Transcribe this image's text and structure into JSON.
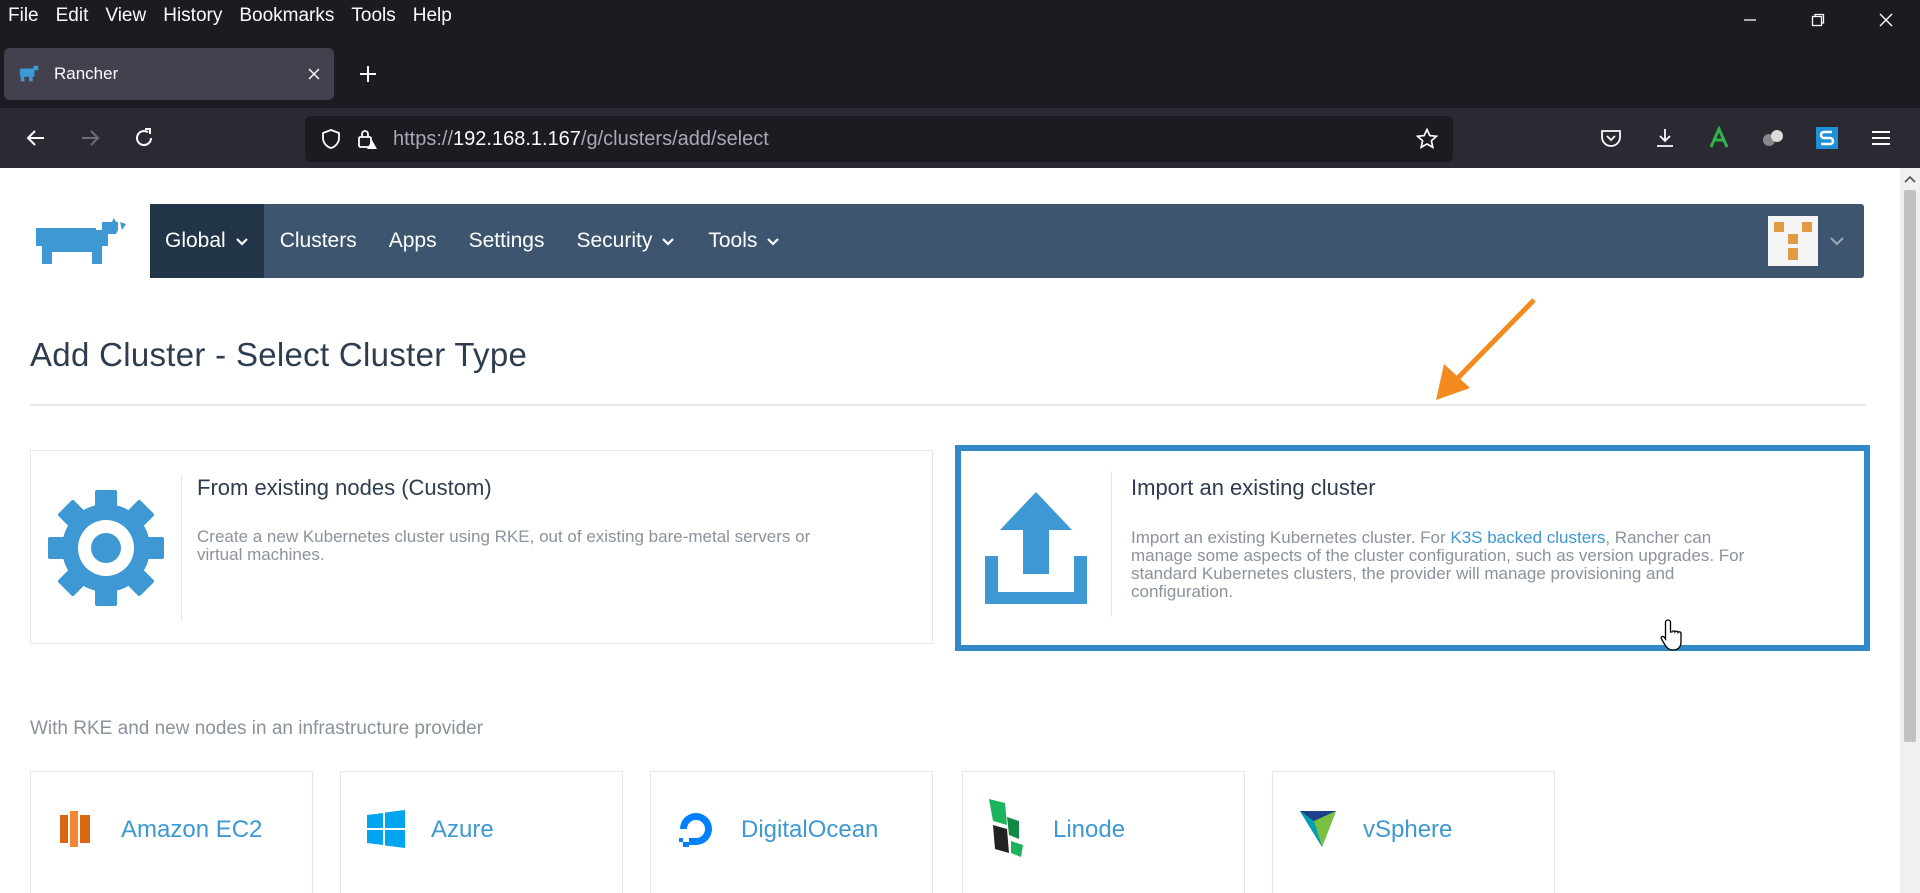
{
  "browser": {
    "menu": [
      "File",
      "Edit",
      "View",
      "History",
      "Bookmarks",
      "Tools",
      "Help"
    ],
    "tab_title": "Rancher",
    "url_prefix": "https://",
    "url_host": "192.168.1.167",
    "url_path": "/g/clusters/add/select"
  },
  "nav": {
    "items": [
      {
        "label": "Global",
        "active": true,
        "dropdown": true
      },
      {
        "label": "Clusters"
      },
      {
        "label": "Apps"
      },
      {
        "label": "Settings"
      },
      {
        "label": "Security",
        "dropdown": true
      },
      {
        "label": "Tools",
        "dropdown": true
      }
    ]
  },
  "page": {
    "title": "Add Cluster - Select Cluster Type",
    "custom_card": {
      "title": "From existing nodes (Custom)",
      "desc_1": "Create a new Kubernetes cluster using RKE, out of existing bare-metal servers or",
      "desc_2": "virtual machines."
    },
    "import_card": {
      "title": "Import an existing cluster",
      "desc_a": "Import an existing Kubernetes cluster. For ",
      "desc_link": "K3S backed clusters",
      "desc_b": ", Rancher can",
      "desc_2": "manage some aspects of the cluster configuration, such as version upgrades. For",
      "desc_3": "standard Kubernetes clusters, the provider will manage provisioning and",
      "desc_4": "configuration."
    },
    "providers_heading": "With RKE and new nodes in an infrastructure provider",
    "providers": [
      "Amazon EC2",
      "Azure",
      "DigitalOcean",
      "Linode",
      "vSphere"
    ]
  },
  "colors": {
    "nav_bg": "#3d556e",
    "nav_active": "#223447",
    "accent_blue": "#3d98d3",
    "highlight_border": "#2f8ac7",
    "arrow": "#f28a1e"
  }
}
